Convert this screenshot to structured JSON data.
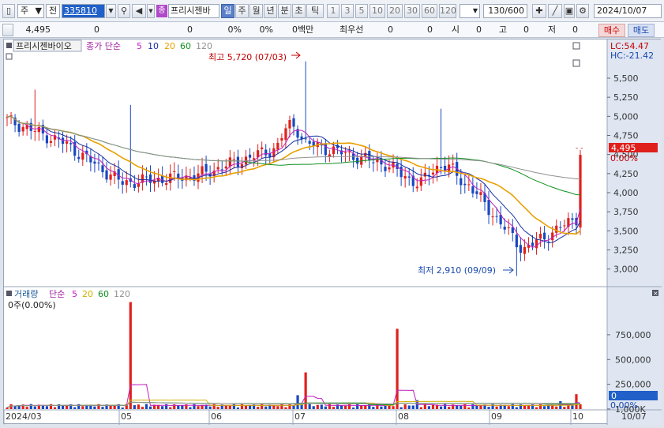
{
  "toolbar": {
    "market": "주",
    "type": "전",
    "code": "335810",
    "search_icon": "magnifier-icon",
    "zero": "0",
    "badge": "종",
    "stock_name": "프리시젠바",
    "periods": [
      "일",
      "주",
      "월",
      "년",
      "분",
      "초",
      "틱"
    ],
    "active_period": "일",
    "intervals": [
      "1",
      "3",
      "5",
      "10",
      "20",
      "30",
      "60",
      "120"
    ],
    "count": "130/600",
    "date": "2024/10/07"
  },
  "info": {
    "price": "4,495",
    "v1": "0",
    "v2": "0",
    "pct1": "0%",
    "pct2": "0%",
    "label_cap": "0백만",
    "label_pref": "최우선",
    "v3": "0",
    "v4": "0",
    "label_open": "시",
    "v5": "0",
    "label_high": "고",
    "v6": "0",
    "label_low": "저",
    "v7": "0",
    "buy": "매수",
    "sell": "매도"
  },
  "price_panel": {
    "stock_label": "프리시젠바이오",
    "ma_prefix": "종가 단순",
    "ma_periods": [
      "5",
      "10",
      "20",
      "60",
      "120"
    ],
    "ma_colors": [
      "#c020c0",
      "#1830a0",
      "#e8a000",
      "#109020",
      "#909090"
    ],
    "lc_label": "LC:54.47",
    "hc_label": "HC:-21.42",
    "high_annotation": "최고 5,720 (07/03)",
    "low_annotation": "최저 2,910 (09/09)",
    "current_price": "4,495",
    "current_pct": "0.00%",
    "y_ticks": [
      "5,500",
      "5,250",
      "5,000",
      "4,750",
      "4,500",
      "4,250",
      "4,000",
      "3,750",
      "3,500",
      "3,250",
      "3,000"
    ]
  },
  "volume_panel": {
    "label": "거래량",
    "ma_prefix": "단순",
    "ma_periods": [
      "5",
      "20",
      "60",
      "120"
    ],
    "ma_colors": [
      "#c020c0",
      "#d0b000",
      "#109020",
      "#909090"
    ],
    "sub_label": "0주(0.00%)",
    "current_volume": "0",
    "current_pct": "0.00%",
    "y_ticks": [
      "1,000K",
      "750,000",
      "500,000",
      "250,000"
    ]
  },
  "x_axis": {
    "labels": [
      "2024/03",
      "05",
      "06",
      "07",
      "08",
      "09",
      "10"
    ],
    "right_label": "10/07"
  },
  "chart_data": {
    "type": "candlestick",
    "price_ylim": [
      2800,
      5800
    ],
    "volume_ylim": [
      0,
      1100000
    ],
    "high": 5720,
    "low": 2910,
    "last_close": 4495,
    "series": [
      {
        "name": "5",
        "values": []
      },
      {
        "name": "10",
        "values": []
      },
      {
        "name": "20",
        "values": []
      },
      {
        "name": "60",
        "values": []
      },
      {
        "name": "120",
        "values": []
      }
    ]
  }
}
